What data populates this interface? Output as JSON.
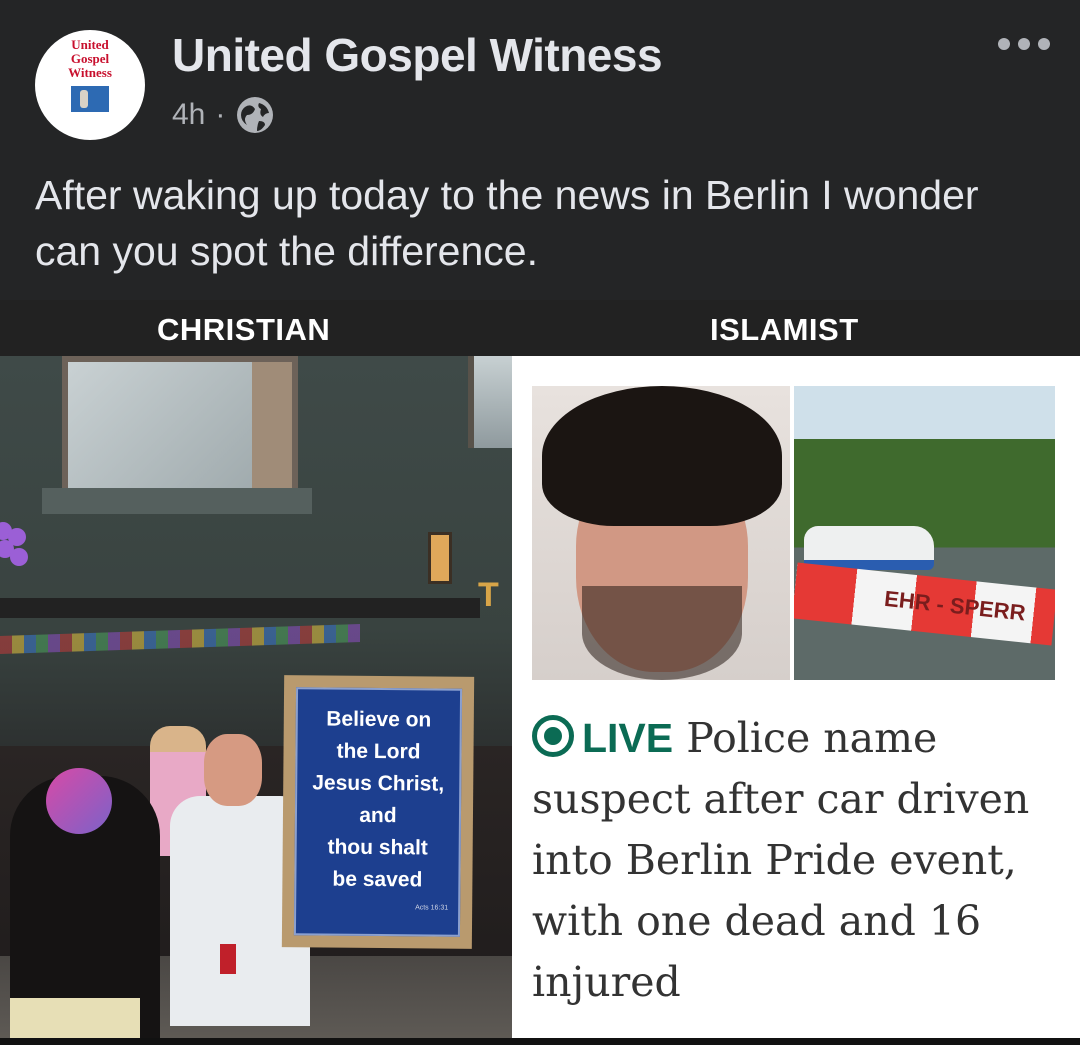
{
  "post": {
    "page_name": "United Gospel Witness",
    "time": "4h",
    "separator": "·",
    "audience_icon": "globe-icon",
    "more_icon": "more-horizontal-icon",
    "avatar": {
      "line1": "United",
      "line2": "Gospel",
      "line3": "Witness"
    },
    "caption": "After waking up today to the news in Berlin I wonder can you spot the difference."
  },
  "image": {
    "left_label": "CHRISTIAN",
    "right_label": "ISLAMIST",
    "sign_lines": [
      "Believe on",
      "the Lord",
      "Jesus Christ,",
      "and",
      "thou shalt",
      "be saved"
    ],
    "sign_ref": "Acts 16:31",
    "storefront_letter": "T",
    "tape_text": "EHR - SPERR",
    "live_label": "LIVE",
    "headline": "Police name suspect after car driven into Berlin Pride event, with one dead and 16 injured",
    "colors": {
      "live_green": "#0b6b54",
      "sign_blue": "#1d3f8f",
      "tape_red": "#e53935"
    }
  }
}
